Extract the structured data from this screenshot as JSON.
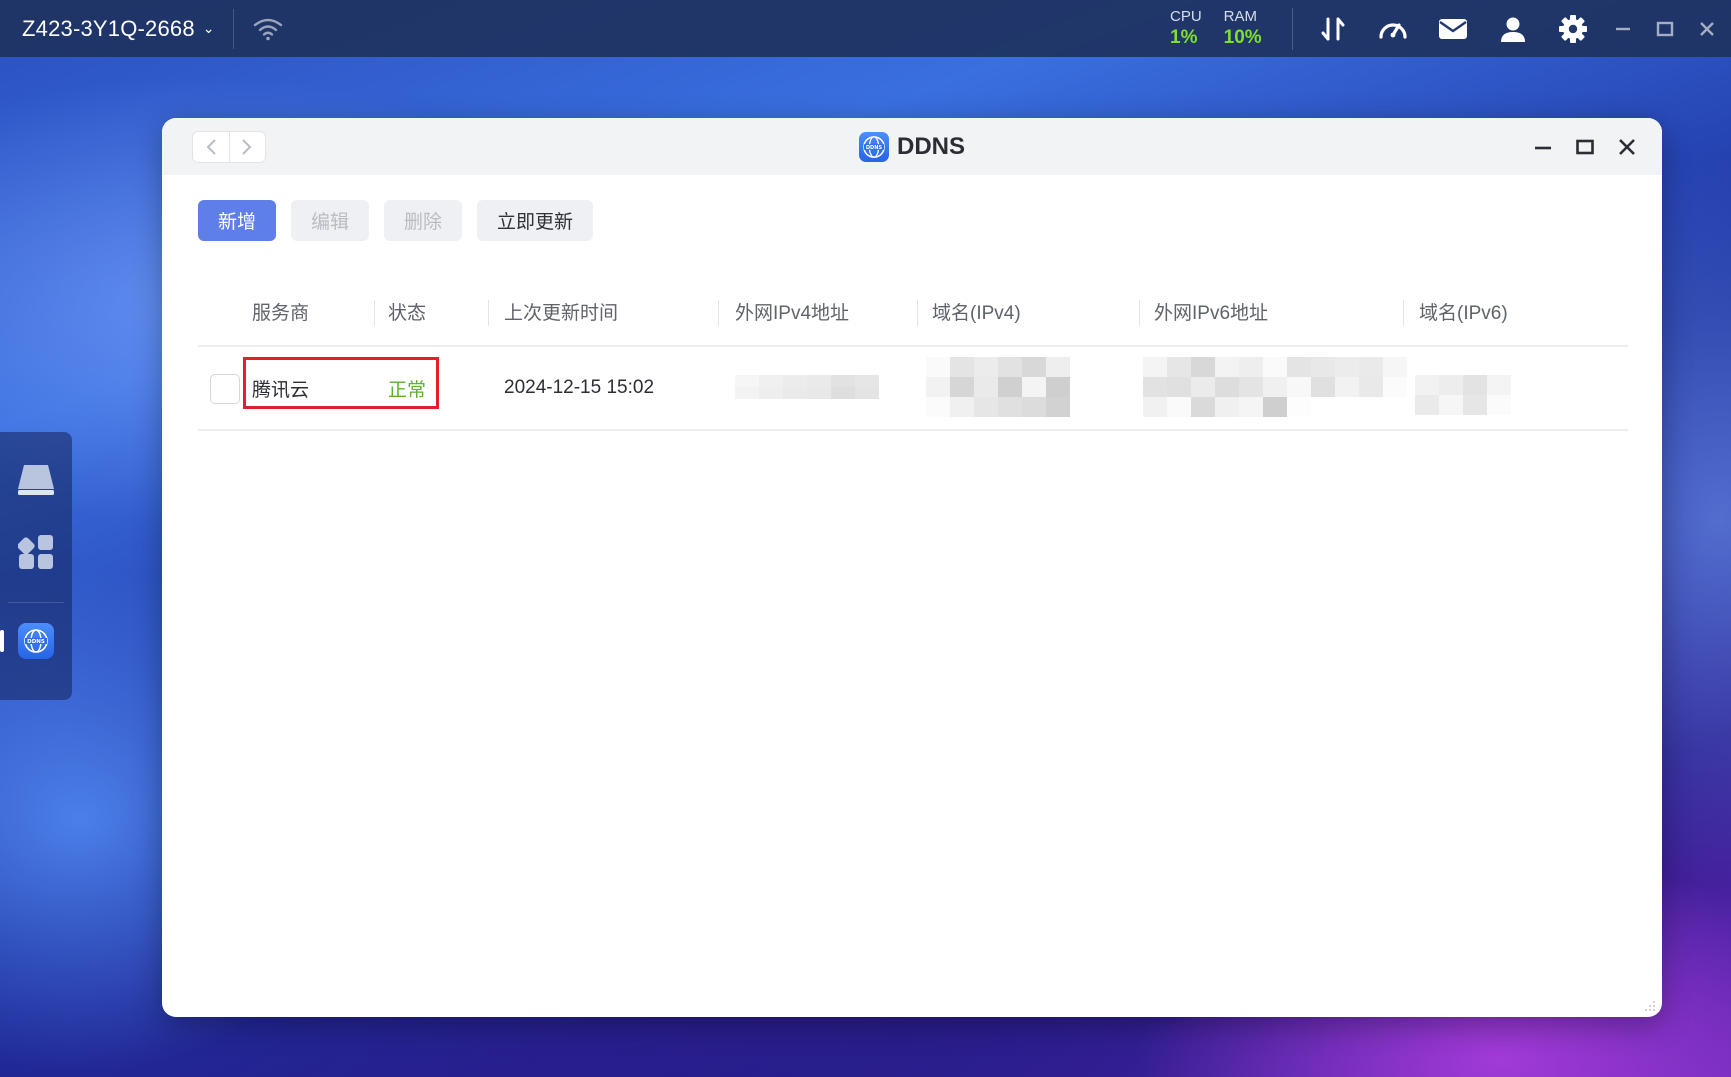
{
  "topbar": {
    "device_name": "Z423-3Y1Q-2668",
    "cpu_label": "CPU",
    "cpu_value": "1%",
    "ram_label": "RAM",
    "ram_value": "10%",
    "accent_green": "#7ee02a"
  },
  "window": {
    "title": "DDNS",
    "app_icon_text": "DDNS"
  },
  "toolbar": {
    "add_label": "新增",
    "edit_label": "编辑",
    "delete_label": "删除",
    "update_label": "立即更新"
  },
  "table": {
    "columns": [
      "服务商",
      "状态",
      "上次更新时间",
      "外网IPv4地址",
      "域名(IPv4)",
      "外网IPv6地址",
      "域名(IPv6)"
    ],
    "rows": [
      {
        "provider": "腾讯云",
        "status": "正常",
        "last_update": "2024-12-15 15:02",
        "ipv4": "",
        "domain_ipv4": "",
        "ipv6": "",
        "domain_ipv6": ""
      }
    ]
  },
  "colors": {
    "primary": "#5f7fe8",
    "status_ok": "#5fb22a",
    "highlight": "#e0202a"
  }
}
